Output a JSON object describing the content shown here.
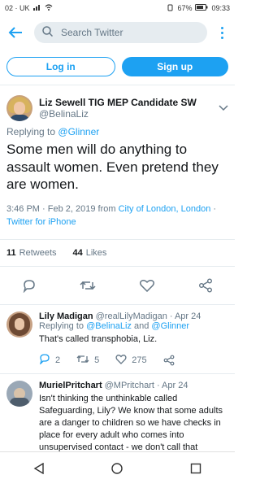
{
  "status_bar": {
    "left": "02 · UK",
    "battery": "67%",
    "time": "09:33"
  },
  "search": {
    "placeholder": "Search Twitter"
  },
  "auth": {
    "login": "Log in",
    "signup": "Sign up"
  },
  "tweet": {
    "name": "Liz Sewell TIG MEP Candidate SW",
    "handle": "@BelinaLiz",
    "replying_prefix": "Replying to",
    "replying_to": "@Glinner",
    "text": "Some men will do anything to assault women. Even pretend they are women.",
    "time": "3:46 PM · Feb 2, 2019 from",
    "location": "City of London, London",
    "separator": "·",
    "client": "Twitter for iPhone",
    "retweets": "11",
    "retweets_label": "Retweets",
    "likes": "44",
    "likes_label": "Likes"
  },
  "replies": [
    {
      "name": "Lily Madigan",
      "handle": "@realLilyMadigan",
      "date": "· Apr 24",
      "replying_prefix": "Replying to",
      "replying_to_1": "@BelinaLiz",
      "replying_and": "and",
      "replying_to_2": "@Glinner",
      "text": "That's called transphobia, Liz.",
      "reply_count": "2",
      "retweet_count": "5",
      "like_count": "275"
    },
    {
      "name": "MurielPritchart",
      "handle": "@MPritchart",
      "date": "· Apr 24",
      "text": "Isn't thinking the unthinkable called Safeguarding, Lily? We know that some adults are a danger to children so we have checks in place for every adult who comes into unsupervised contact - we don't call that"
    }
  ],
  "colors": {
    "accent": "#1da1f2",
    "muted": "#657786",
    "divider": "#e6ecf0"
  },
  "icons": [
    "back-arrow-icon",
    "search-icon",
    "more-icon",
    "chevron-down-icon",
    "reply-icon",
    "retweet-icon",
    "like-icon",
    "share-icon",
    "nav-back-icon",
    "nav-home-icon",
    "nav-recents-icon"
  ]
}
